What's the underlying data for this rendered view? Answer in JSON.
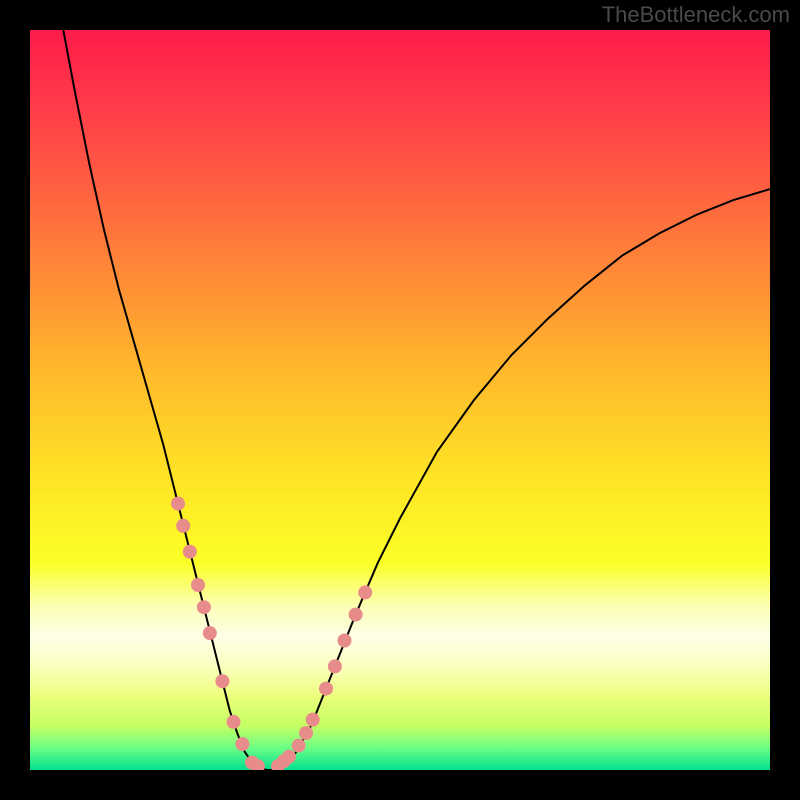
{
  "watermark": "TheBottleneck.com",
  "chart_data": {
    "type": "line",
    "title": "",
    "xlabel": "",
    "ylabel": "",
    "xlim": [
      0,
      100
    ],
    "ylim": [
      0,
      100
    ],
    "background_gradient": {
      "stops": [
        {
          "pos": 0.0,
          "color": "#ff1b4a"
        },
        {
          "pos": 0.1,
          "color": "#ff3a4a"
        },
        {
          "pos": 0.25,
          "color": "#ff6d3e"
        },
        {
          "pos": 0.45,
          "color": "#ffb52c"
        },
        {
          "pos": 0.6,
          "color": "#ffe326"
        },
        {
          "pos": 0.72,
          "color": "#fbff26"
        },
        {
          "pos": 0.78,
          "color": "#fcffb8"
        },
        {
          "pos": 0.82,
          "color": "#feffe6"
        },
        {
          "pos": 0.86,
          "color": "#fbffbf"
        },
        {
          "pos": 0.9,
          "color": "#ecff7c"
        },
        {
          "pos": 0.94,
          "color": "#c6ff63"
        },
        {
          "pos": 0.97,
          "color": "#6cff84"
        },
        {
          "pos": 1.0,
          "color": "#00e08f"
        }
      ]
    },
    "series": [
      {
        "name": "curve",
        "color": "#000000",
        "stroke_width": 2,
        "x": [
          4.5,
          6,
          8,
          10,
          12,
          14,
          16,
          18,
          20,
          21,
          22,
          23,
          24,
          25,
          26,
          27,
          28,
          29,
          30,
          31,
          32,
          33,
          34,
          35,
          36,
          38,
          40,
          42,
          44,
          47,
          50,
          55,
          60,
          65,
          70,
          75,
          80,
          85,
          90,
          95,
          100
        ],
        "y": [
          100,
          92,
          82,
          73,
          65,
          58,
          51,
          44,
          36,
          32,
          28,
          24,
          20,
          16,
          12,
          8,
          5,
          2.5,
          1.0,
          0.3,
          0.0,
          0.0,
          0.3,
          1.0,
          2.5,
          6,
          11,
          16,
          21,
          28,
          34,
          43,
          50,
          56,
          61,
          65.5,
          69.5,
          72.5,
          75,
          77,
          78.5
        ]
      },
      {
        "name": "markers-left",
        "type": "scatter",
        "color": "#e88b8b",
        "radius": 7,
        "x": [
          20.0,
          20.7,
          21.6,
          22.7,
          23.5,
          24.3,
          26.0,
          27.5,
          28.7,
          30.0,
          30.8
        ],
        "y": [
          36.0,
          33.0,
          29.5,
          25.0,
          22.0,
          18.5,
          12.0,
          6.5,
          3.5,
          1.0,
          0.5
        ]
      },
      {
        "name": "markers-right",
        "type": "scatter",
        "color": "#e88b8b",
        "radius": 7,
        "x": [
          33.5,
          34.3,
          35.0,
          36.3,
          37.3,
          38.2,
          40.0,
          41.2,
          42.5,
          44.0,
          45.3
        ],
        "y": [
          0.5,
          1.2,
          1.8,
          3.3,
          5.0,
          6.8,
          11.0,
          14.0,
          17.5,
          21.0,
          24.0
        ]
      }
    ]
  }
}
